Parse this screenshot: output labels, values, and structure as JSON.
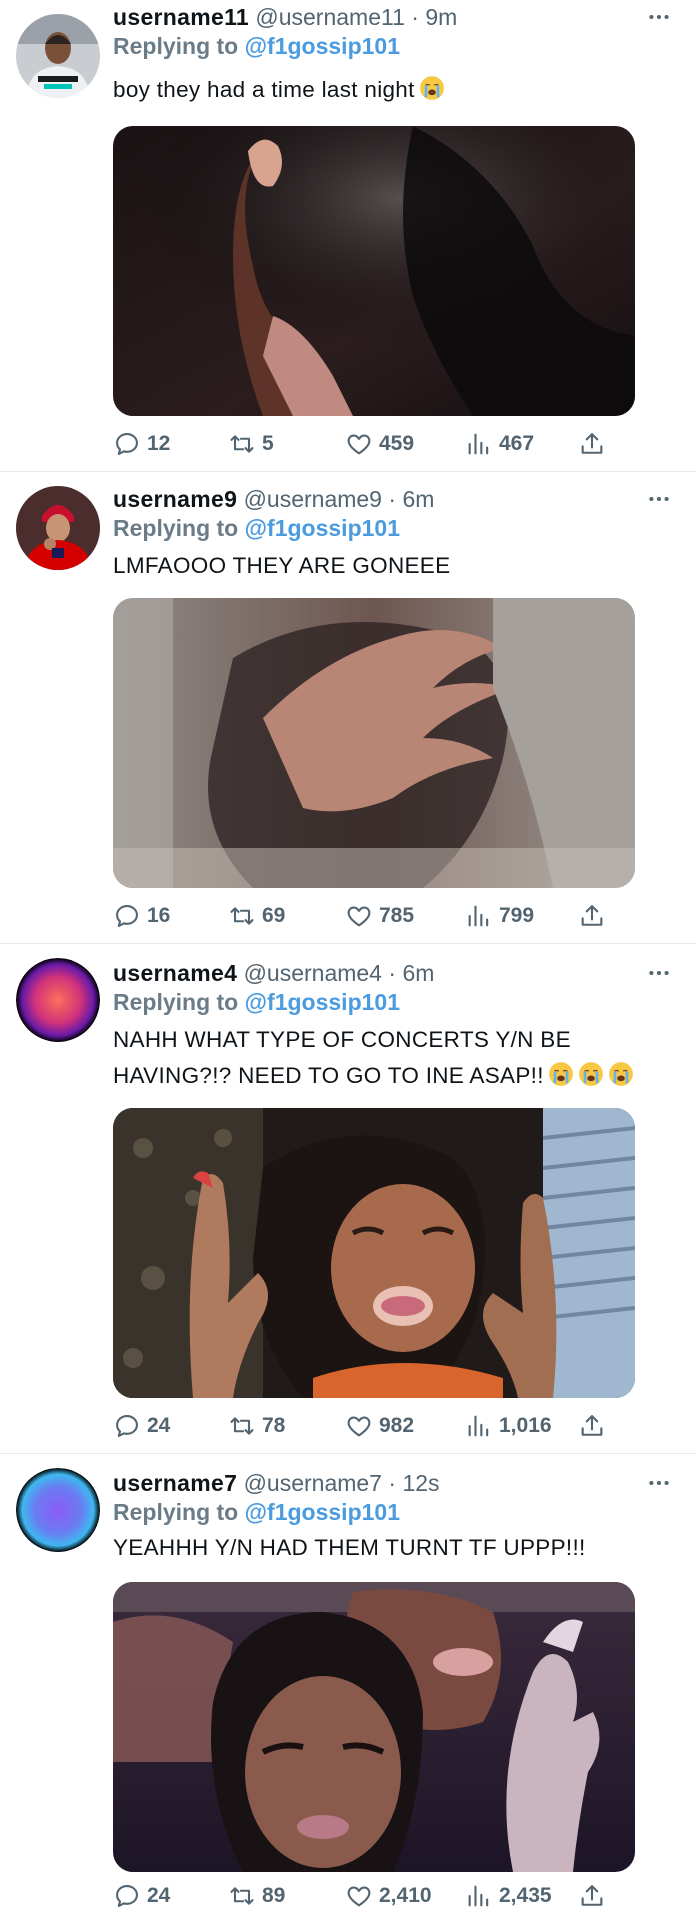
{
  "tweets": [
    {
      "name": "username11",
      "handle": "@username11",
      "dot": "·",
      "time": "9m",
      "replying_to_label": "Replying to",
      "replying_to": "@f1gossip101",
      "text": "boy they had a time last night",
      "emoji": [
        "loudly-crying-face"
      ],
      "stats": {
        "replies": "12",
        "retweets": "5",
        "likes": "459",
        "views": "467"
      }
    },
    {
      "name": "username9",
      "handle": "@username9",
      "dot": "·",
      "time": "6m",
      "replying_to_label": "Replying to",
      "replying_to": "@f1gossip101",
      "text": "LMFAOOO THEY ARE GONEEE",
      "emoji": [],
      "stats": {
        "replies": "16",
        "retweets": "69",
        "likes": "785",
        "views": "799"
      }
    },
    {
      "name": "username4",
      "handle": "@username4",
      "dot": "·",
      "time": "6m",
      "replying_to_label": "Replying to",
      "replying_to": "@f1gossip101",
      "text_line1": "NAHH WHAT TYPE OF CONCERTS Y/N BE",
      "text_line2": "HAVING?!? NEED TO GO TO INE ASAP!!",
      "emoji": [
        "loudly-crying-face",
        "loudly-crying-face",
        "loudly-crying-face"
      ],
      "stats": {
        "replies": "24",
        "retweets": "78",
        "likes": "982",
        "views": "1,016"
      }
    },
    {
      "name": "username7",
      "handle": "@username7",
      "dot": "·",
      "time": "12s",
      "replying_to_label": "Replying to",
      "replying_to": "@f1gossip101",
      "text": "YEAHHH Y/N HAD THEM TURNT TF UPPP!!!",
      "emoji": [],
      "stats": {
        "replies": "24",
        "retweets": "89",
        "likes": "2,410",
        "views": "2,435"
      }
    }
  ],
  "colors": {
    "mention": "#4a9be0",
    "secondary_text": "#536471",
    "divider": "#e6e9ec"
  },
  "icons": [
    "more-icon",
    "reply-icon",
    "retweet-icon",
    "like-icon",
    "views-icon",
    "share-icon"
  ]
}
